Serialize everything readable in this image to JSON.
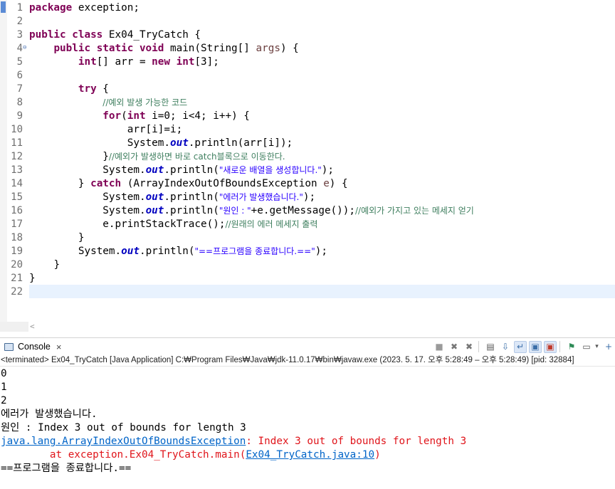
{
  "editor": {
    "gutter": [
      "1",
      "2",
      "3",
      "4",
      "5",
      "6",
      "7",
      "8",
      "9",
      "10",
      "11",
      "12",
      "13",
      "14",
      "15",
      "16",
      "17",
      "18",
      "19",
      "20",
      "21",
      "22"
    ],
    "fold_marker": "⊖",
    "lines": {
      "l1": {
        "kw": "package",
        "rest": " exception;"
      },
      "l3": {
        "kw": "public class",
        "rest": " Ex04_TryCatch {"
      },
      "l4": {
        "indent": "    ",
        "kw": "public static void",
        "rest": " main(String[] ",
        "var": "args",
        "tail": ") {"
      },
      "l5": {
        "indent": "        ",
        "kw1": "int",
        "mid": "[] arr = ",
        "kw2": "new",
        "sp": " ",
        "kw3": "int",
        "rest": "[3];"
      },
      "l7": {
        "indent": "        ",
        "kw": "try",
        "rest": " {"
      },
      "l8": {
        "indent": "            ",
        "comment": "//예외 발생 가능한 코드"
      },
      "l9": {
        "indent": "            ",
        "kw1": "for",
        "a": "(",
        "kw2": "int",
        "rest": " i=0; i<4; i++) {"
      },
      "l10": {
        "indent": "                ",
        "text": "arr[i]=i;"
      },
      "l11": {
        "indent": "                ",
        "a": "System.",
        "field": "out",
        "rest": ".println(arr[i]);"
      },
      "l12": {
        "indent": "            ",
        "a": "}",
        "comment": "//예외가 발생하면 바로 catch블록으로 이동한다."
      },
      "l13": {
        "indent": "            ",
        "a": "System.",
        "field": "out",
        "b": ".println(",
        "str": "\"새로운 배열을 생성합니다.\"",
        "rest": ");"
      },
      "l14": {
        "indent": "        ",
        "a": "} ",
        "kw": "catch",
        "rest": " (ArrayIndexOutOfBoundsException ",
        "var": "e",
        "tail": ") {"
      },
      "l15": {
        "indent": "            ",
        "a": "System.",
        "field": "out",
        "b": ".println(",
        "str": "\"에러가 발생했습니다.\"",
        "rest": ");"
      },
      "l16": {
        "indent": "            ",
        "a": "System.",
        "field": "out",
        "b": ".println(",
        "str": "\"원인 : \"",
        "rest": "+e.getMessage());",
        "comment": "//예외가 가지고 있는 메세지 얻기"
      },
      "l17": {
        "indent": "            ",
        "a": "e.printStackTrace();",
        "comment": "//원래의 에러 메세지 출력"
      },
      "l18": {
        "indent": "        ",
        "text": "}"
      },
      "l19": {
        "indent": "        ",
        "a": "System.",
        "field": "out",
        "b": ".println(",
        "str": "\"==프로그램을 종료합니다.==\"",
        "rest": ");"
      },
      "l20": {
        "indent": "    ",
        "text": "}"
      },
      "l21": {
        "text": "}"
      }
    },
    "hscroll_arrow": "<"
  },
  "console": {
    "tab_label": "Console",
    "tab_close": "×",
    "status": "<terminated> Ex04_TryCatch [Java Application] C:₩Program Files₩Java₩jdk-11.0.17₩bin₩javaw.exe  (2023. 5. 17. 오후 5:28:49 – 오후 5:28:49) [pid: 32884]",
    "toolbar_icons": [
      "terminate-icon",
      "remove-launch-icon",
      "remove-all-icon",
      "clear-console-icon",
      "scroll-lock-icon",
      "word-wrap-icon",
      "show-on-stdout-icon",
      "show-on-stderr-icon",
      "pin-console-icon",
      "display-console-icon",
      "new-console-icon"
    ],
    "toolbar_glyphs": [
      "■",
      "✖",
      "✖",
      "▤",
      "⇩",
      "↵",
      "▣",
      "▣",
      "⚑",
      "▭",
      "+"
    ],
    "dropdown_glyph": "▾",
    "output": {
      "o1": "0",
      "o2": "1",
      "o3": "2",
      "o4": "에러가 발생했습니다.",
      "o5": "원인 : Index 3 out of bounds for length 3",
      "o6_link": "java.lang.ArrayIndexOutOfBoundsException",
      "o6_rest": ": Index 3 out of bounds for length 3",
      "o7_pre": "\tat exception.Ex04_TryCatch.main(",
      "o7_link": "Ex04_TryCatch.java:10",
      "o7_post": ")",
      "o8": "==프로그램을 종료합니다.=="
    }
  },
  "colors": {
    "keyword": "#7f0055",
    "string": "#2a00ff",
    "comment": "#3f7f5f",
    "static_field": "#0000c0",
    "stderr": "#e0151b",
    "link": "#0064c8",
    "current_line": "#e8f2fe"
  }
}
